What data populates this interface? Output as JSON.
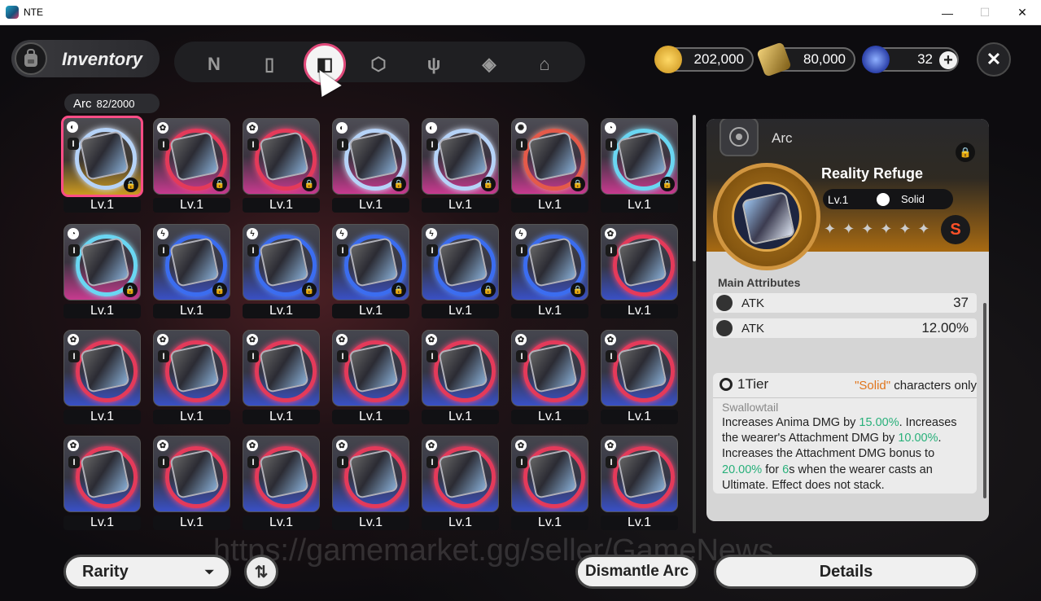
{
  "window": {
    "title": "NTE",
    "minimize": "—",
    "maximize": "☐",
    "close": "✕"
  },
  "header": {
    "title": "Inventory",
    "tabs": [
      {
        "icon": "n-logo-icon",
        "glyph": "N"
      },
      {
        "icon": "gameboy-icon",
        "glyph": "▯"
      },
      {
        "icon": "arc-icon",
        "glyph": "◧",
        "active": true
      },
      {
        "icon": "cube-icon",
        "glyph": "⬡"
      },
      {
        "icon": "utensils-icon",
        "glyph": "ψ"
      },
      {
        "icon": "gem-icon",
        "glyph": "◈"
      },
      {
        "icon": "home-icon",
        "glyph": "⌂"
      }
    ],
    "currencies": [
      {
        "icon": "gold-coin-icon",
        "value": "202,000",
        "color": "#e8b93a"
      },
      {
        "icon": "ticket-icon",
        "value": "80,000",
        "color": "#d9b44a"
      },
      {
        "icon": "crystal-icon",
        "value": "32",
        "color": "#4a78ff"
      }
    ],
    "add_label": "+",
    "close_label": "✕"
  },
  "arc_count": {
    "label": "Arc",
    "value": "82/2000"
  },
  "items": [
    {
      "lv": "Lv.1",
      "bg": "gold",
      "ring": "w",
      "glyph": "◐",
      "locked": true,
      "selected": true
    },
    {
      "lv": "Lv.1",
      "bg": "pink",
      "ring": "",
      "glyph": "✿",
      "locked": true
    },
    {
      "lv": "Lv.1",
      "bg": "pink",
      "ring": "",
      "glyph": "✿",
      "locked": true
    },
    {
      "lv": "Lv.1",
      "bg": "pink",
      "ring": "w",
      "glyph": "◐",
      "locked": true
    },
    {
      "lv": "Lv.1",
      "bg": "pink",
      "ring": "w",
      "glyph": "◐",
      "locked": true
    },
    {
      "lv": "Lv.1",
      "bg": "pink",
      "ring": "r",
      "glyph": "✺",
      "locked": true
    },
    {
      "lv": "Lv.1",
      "bg": "pink",
      "ring": "c",
      "glyph": "◔",
      "locked": true
    },
    {
      "lv": "Lv.1",
      "bg": "pink",
      "ring": "c",
      "glyph": "◔",
      "locked": true
    },
    {
      "lv": "Lv.1",
      "bg": "blue",
      "ring": "b",
      "glyph": "ϟ",
      "locked": true
    },
    {
      "lv": "Lv.1",
      "bg": "blue",
      "ring": "b",
      "glyph": "ϟ",
      "locked": true
    },
    {
      "lv": "Lv.1",
      "bg": "blue",
      "ring": "b",
      "glyph": "ϟ",
      "locked": true
    },
    {
      "lv": "Lv.1",
      "bg": "blue",
      "ring": "b",
      "glyph": "ϟ",
      "locked": true
    },
    {
      "lv": "Lv.1",
      "bg": "blue",
      "ring": "b",
      "glyph": "ϟ",
      "locked": true
    },
    {
      "lv": "Lv.1",
      "bg": "blue",
      "ring": "",
      "glyph": "✿",
      "locked": false
    },
    {
      "lv": "Lv.1",
      "bg": "blue",
      "ring": "",
      "glyph": "✿",
      "locked": false
    },
    {
      "lv": "Lv.1",
      "bg": "blue",
      "ring": "",
      "glyph": "✿",
      "locked": false
    },
    {
      "lv": "Lv.1",
      "bg": "blue",
      "ring": "",
      "glyph": "✿",
      "locked": false
    },
    {
      "lv": "Lv.1",
      "bg": "blue",
      "ring": "",
      "glyph": "✿",
      "locked": false
    },
    {
      "lv": "Lv.1",
      "bg": "blue",
      "ring": "",
      "glyph": "✿",
      "locked": false
    },
    {
      "lv": "Lv.1",
      "bg": "blue",
      "ring": "",
      "glyph": "✿",
      "locked": false
    },
    {
      "lv": "Lv.1",
      "bg": "blue",
      "ring": "",
      "glyph": "✿",
      "locked": false
    },
    {
      "lv": "Lv.1",
      "bg": "blue",
      "ring": "",
      "glyph": "✿",
      "locked": false
    },
    {
      "lv": "Lv.1",
      "bg": "blue",
      "ring": "",
      "glyph": "✿",
      "locked": false
    },
    {
      "lv": "Lv.1",
      "bg": "blue",
      "ring": "",
      "glyph": "✿",
      "locked": false
    },
    {
      "lv": "Lv.1",
      "bg": "blue",
      "ring": "",
      "glyph": "✿",
      "locked": false
    },
    {
      "lv": "Lv.1",
      "bg": "blue",
      "ring": "",
      "glyph": "✿",
      "locked": false
    },
    {
      "lv": "Lv.1",
      "bg": "blue",
      "ring": "",
      "glyph": "✿",
      "locked": false
    },
    {
      "lv": "Lv.1",
      "bg": "blue",
      "ring": "",
      "glyph": "✿",
      "locked": false
    }
  ],
  "detail": {
    "header": "Arc",
    "name": "Reality Refuge",
    "level": "Lv.1",
    "class": "Solid",
    "stars": "✦✦✦✦✦✦",
    "badge": "S",
    "main_attributes_label": "Main Attributes",
    "attributes": [
      {
        "name": "ATK",
        "value": "37"
      },
      {
        "name": "ATK",
        "value": "12.00%"
      }
    ],
    "tier": "1Tier",
    "req_q": "\"Solid\"",
    "req_rest": " characters only",
    "skill": "Swallowtail",
    "desc": [
      {
        "t": "Increases Anima DMG by ",
        "g": false
      },
      {
        "t": "15.00%",
        "g": true
      },
      {
        "t": ". Increases the wearer's Attachment DMG by ",
        "g": false
      },
      {
        "t": "10.00%",
        "g": true
      },
      {
        "t": ". Increases the Attachment DMG bonus to ",
        "g": false
      },
      {
        "t": "20.00%",
        "g": true
      },
      {
        "t": " for ",
        "g": false
      },
      {
        "t": "6",
        "g": true
      },
      {
        "t": "s when the wearer casts an Ultimate. Effect does not stack.",
        "g": false
      }
    ]
  },
  "footer": {
    "rarity": "Rarity",
    "rarity_caret": "⏷",
    "sort_glyph": "⇅",
    "dismantle": "Dismantle Arc",
    "details": "Details"
  },
  "watermark": "https://gamemarket.gg/seller/GameNews"
}
